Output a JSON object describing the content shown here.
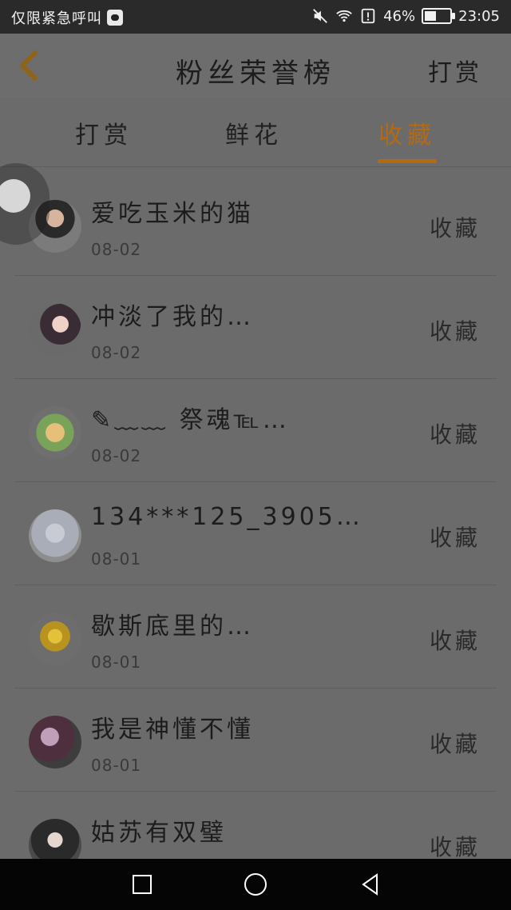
{
  "status_bar": {
    "left_text": "仅限紧急呼叫",
    "battery_percent": "46%",
    "time": "23:05",
    "battery_level": 0.46
  },
  "header": {
    "title": "粉丝荣誉榜",
    "right_action": "打赏",
    "back_icon": "chevron-left-icon"
  },
  "tabs": [
    {
      "label": "打赏",
      "active": false
    },
    {
      "label": "鲜花",
      "active": false
    },
    {
      "label": "收藏",
      "active": true
    }
  ],
  "list": {
    "items": [
      {
        "name": "爱吃玉米的猫",
        "date": "08-02",
        "action": "收藏",
        "avatar_icon": "avatar-icon"
      },
      {
        "name": "冲淡了我的…",
        "date": "08-02",
        "action": "收藏",
        "avatar_icon": "avatar-icon"
      },
      {
        "name": "✎﹏﹏ 祭魂℡…",
        "date": "08-02",
        "action": "收藏",
        "avatar_icon": "avatar-icon"
      },
      {
        "name": "134***125_3905…",
        "date": "08-01",
        "action": "收藏",
        "avatar_icon": "avatar-icon"
      },
      {
        "name": "歇斯底里的…",
        "date": "08-01",
        "action": "收藏",
        "avatar_icon": "avatar-icon"
      },
      {
        "name": "我是神懂不懂",
        "date": "08-01",
        "action": "收藏",
        "avatar_icon": "avatar-icon"
      },
      {
        "name": "姑苏有双璧",
        "date": "",
        "action": "收藏",
        "avatar_icon": "avatar-icon"
      }
    ]
  },
  "colors": {
    "accent": "#b56a12",
    "overlay": "#6b6b6b"
  }
}
